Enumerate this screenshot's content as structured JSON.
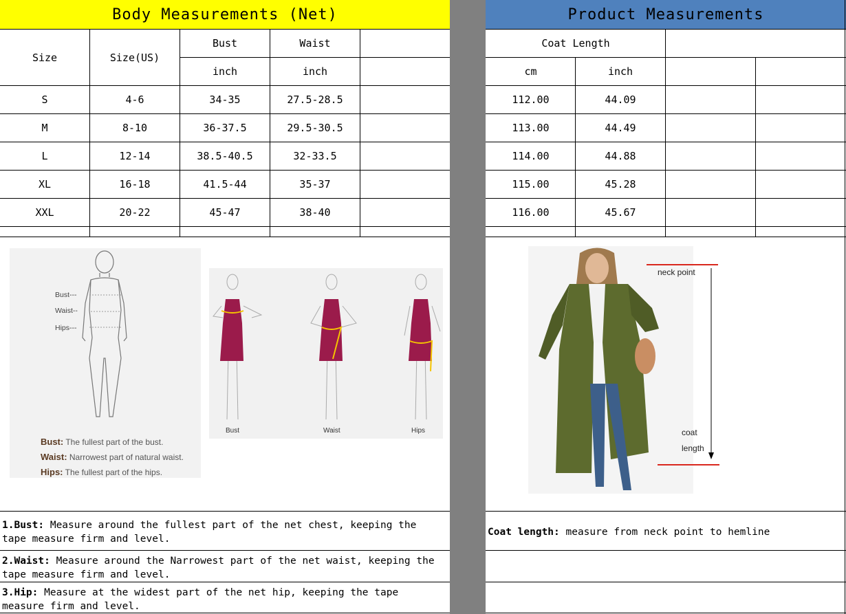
{
  "left_header": "Body Measurements (Net)",
  "right_header": "Product Measurements",
  "left_table": {
    "size": "Size",
    "size_us": "Size(US)",
    "bust": "Bust",
    "waist": "Waist",
    "unit_inch": "inch",
    "rows": [
      {
        "size": "S",
        "us": "4-6",
        "bust": "34-35",
        "waist": "27.5-28.5"
      },
      {
        "size": "M",
        "us": "8-10",
        "bust": "36-37.5",
        "waist": "29.5-30.5"
      },
      {
        "size": "L",
        "us": "12-14",
        "bust": "38.5-40.5",
        "waist": "32-33.5"
      },
      {
        "size": "XL",
        "us": "16-18",
        "bust": "41.5-44",
        "waist": "35-37"
      },
      {
        "size": "XXL",
        "us": "20-22",
        "bust": "45-47",
        "waist": "38-40"
      }
    ]
  },
  "right_table": {
    "coat_length": "Coat Length",
    "unit_cm": "cm",
    "unit_inch": "inch",
    "rows": [
      {
        "cm": "112.00",
        "inch": "44.09"
      },
      {
        "cm": "113.00",
        "inch": "44.49"
      },
      {
        "cm": "114.00",
        "inch": "44.88"
      },
      {
        "cm": "115.00",
        "inch": "45.28"
      },
      {
        "cm": "116.00",
        "inch": "45.67"
      }
    ]
  },
  "figure_body": {
    "bust_tag": "Bust---",
    "waist_tag": "Waist--",
    "hips_tag": "Hips---",
    "bust_title": "Bust:",
    "bust_desc": "The fullest part of the bust.",
    "waist_title": "Waist:",
    "waist_desc": "Narrowest part of natural waist.",
    "hips_title": "Hips:",
    "hips_desc": "The fullest part of the hips."
  },
  "figure_dress": {
    "bust": "Bust",
    "waist": "Waist",
    "hips": "Hips"
  },
  "figure_coat": {
    "neck_point": "neck point",
    "coat": "coat",
    "length": "length"
  },
  "notes": {
    "bust_label": "1.Bust:",
    "bust_text": " Measure around the fullest part of the net chest, keeping the tape  measure firm and level.",
    "waist_label": "2.Waist:",
    "waist_text": " Measure around the Narrowest part of the net waist, keeping the tape  measure firm and level.",
    "hip_label": "3.Hip:",
    "hip_text": " Measure at the widest part of the net hip, keeping the tape measure firm and level.",
    "coat_label": "Coat length:",
    "coat_text": " measure from neck point to hemline"
  },
  "colors": {
    "yellow_header": "#ffff00",
    "blue_header": "#4f81bd",
    "gray_separator": "#808080",
    "dress": "#9b1b4b",
    "coat": "#5d6b2e"
  }
}
